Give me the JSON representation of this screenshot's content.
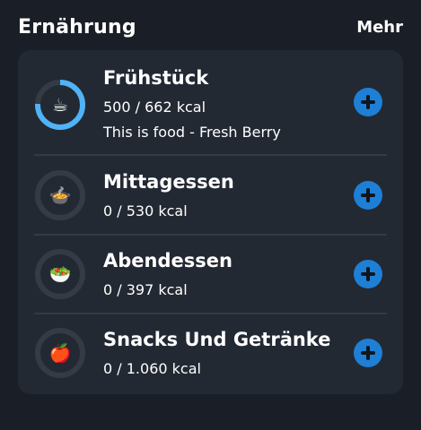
{
  "header": {
    "title": "Ernährung",
    "more_label": "Mehr"
  },
  "colors": {
    "background": "#1a1f27",
    "card": "#232933",
    "ring_track": "#343b46",
    "ring_progress": "#4fb3f6",
    "add_button": "#1e7fd6"
  },
  "meals": [
    {
      "title": "Frühstück",
      "kcal": "500 / 662 kcal",
      "food": "This is food - Fresh Berry",
      "icon": "☕",
      "icon_name": "coffee-icon",
      "progress": 0.755
    },
    {
      "title": "Mittagessen",
      "kcal": "0 / 530 kcal",
      "icon": "🍲",
      "icon_name": "pot-of-food-icon",
      "progress": 0
    },
    {
      "title": "Abendessen",
      "kcal": "0 / 397 kcal",
      "icon": "🥗",
      "icon_name": "salad-icon",
      "progress": 0
    },
    {
      "title": "Snacks Und Getränke",
      "kcal": "0 / 1.060 kcal",
      "icon": "🍎",
      "icon_name": "apple-icon",
      "progress": 0
    }
  ]
}
